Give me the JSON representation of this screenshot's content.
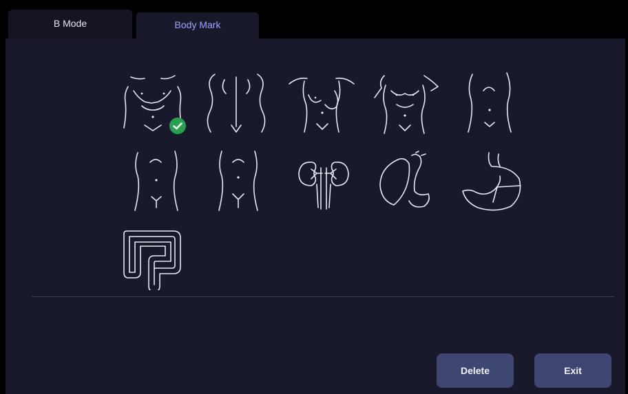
{
  "tabs": [
    {
      "label": "B Mode",
      "active": false
    },
    {
      "label": "Body Mark",
      "active": true
    }
  ],
  "body_marks": [
    {
      "icon": "torso-front-ribcage-icon",
      "selected": true
    },
    {
      "icon": "torso-back-spine-icon",
      "selected": false
    },
    {
      "icon": "female-torso-breast-icon",
      "selected": false
    },
    {
      "icon": "male-torso-arms-icon",
      "selected": false
    },
    {
      "icon": "abdomen-icon",
      "selected": false
    },
    {
      "icon": "lower-abdomen-icon",
      "selected": false
    },
    {
      "icon": "pelvis-icon",
      "selected": false
    },
    {
      "icon": "kidneys-icon",
      "selected": false
    },
    {
      "icon": "liver-gallbladder-icon",
      "selected": false
    },
    {
      "icon": "stomach-icon",
      "selected": false
    },
    {
      "icon": "intestine-icon",
      "selected": false
    }
  ],
  "selected_icon": "checkmark-icon",
  "buttons": {
    "delete_label": "Delete",
    "exit_label": "Exit"
  },
  "colors": {
    "background": "#181a2c",
    "active_tab_text": "#9aa2ff",
    "button": "#3f4671",
    "check": "#27a04f"
  }
}
